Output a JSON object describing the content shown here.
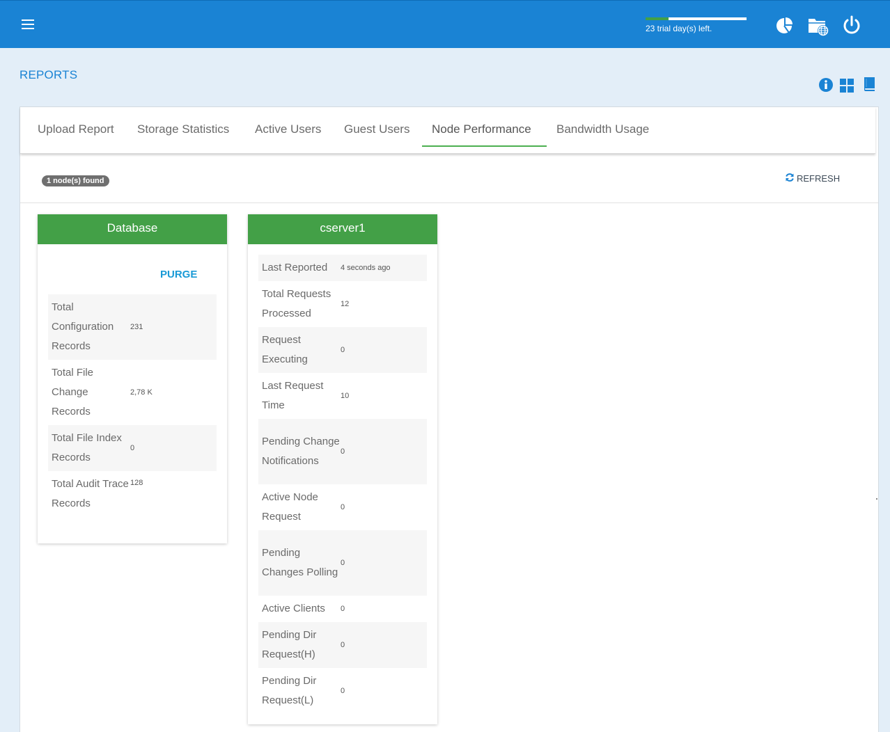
{
  "topbar": {
    "trial_text": "23 trial day(s) left.",
    "trial_progress": 0.23,
    "icons": [
      "menu-icon",
      "pie-chart-icon",
      "folder-globe-icon",
      "power-icon"
    ]
  },
  "page": {
    "title": "REPORTS"
  },
  "header_icons": [
    "info-icon",
    "grid-view-icon",
    "book-icon"
  ],
  "tabs": [
    {
      "label": "Upload Report",
      "active": false
    },
    {
      "label": "Storage Statistics",
      "active": false
    },
    {
      "label": "Active Users",
      "active": false
    },
    {
      "label": "Guest Users",
      "active": false
    },
    {
      "label": "Node Performance",
      "active": true
    },
    {
      "label": "Bandwidth Usage",
      "active": false
    }
  ],
  "toolbar": {
    "badge": "1 node(s) found",
    "refresh_label": "REFRESH"
  },
  "database_card": {
    "title": "Database",
    "purge_label": "PURGE",
    "rows": [
      {
        "label": "Total Configuration Records",
        "value": "231"
      },
      {
        "label": "Total File Change Records",
        "value": "2,78 K"
      },
      {
        "label": "Total File Index Records",
        "value": "0"
      },
      {
        "label": "Total Audit Trace Records",
        "value": "128"
      }
    ]
  },
  "server_card": {
    "title": "cserver1",
    "rows": [
      {
        "label": "Last Reported",
        "value": "4 seconds ago"
      },
      {
        "label": "Total Requests Processed",
        "value": "12"
      },
      {
        "label": "Request Executing",
        "value": "0"
      },
      {
        "label": "Last Request Time",
        "value": "10"
      },
      {
        "label": "Pending Change Notifications",
        "value": "0"
      },
      {
        "label": "Active Node Request",
        "value": "0"
      },
      {
        "label": "Pending Changes Polling",
        "value": "0"
      },
      {
        "label": "Active Clients",
        "value": "0"
      },
      {
        "label": "Pending Dir Request(H)",
        "value": "0"
      },
      {
        "label": "Pending Dir Request(L)",
        "value": "0"
      }
    ]
  },
  "colors": {
    "brand": "#1a83d4",
    "accent_green": "#43a047",
    "link": "#1a9ad6",
    "page_bg": "#e3eef8"
  }
}
